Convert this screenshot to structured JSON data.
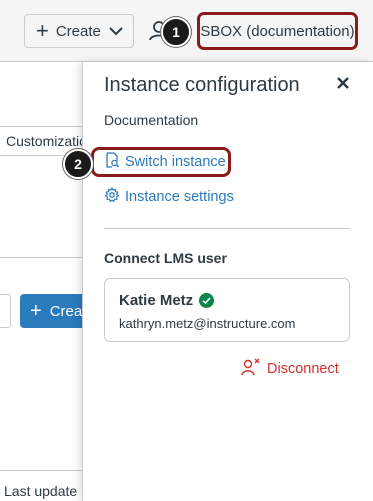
{
  "topbar": {
    "create_label": "Create",
    "instance_label": "SBOX (documentation)"
  },
  "callouts": {
    "one": "1",
    "two": "2"
  },
  "left": {
    "tab_label": "Customizatio",
    "create_label": "Crea",
    "last_updated_label": "Last update"
  },
  "panel": {
    "title": "Instance configuration",
    "subtitle": "Documentation",
    "switch_instance_label": "Switch instance",
    "instance_settings_label": "Instance settings",
    "lms_heading": "Connect LMS user",
    "user_name": "Katie Metz",
    "user_email": "kathryn.metz@instructure.com",
    "disconnect_label": "Disconnect"
  },
  "colors": {
    "link": "#2b7abc",
    "danger": "#d0342c",
    "success": "#0b874b",
    "highlight_border": "#8b1a1a",
    "primary_button": "#2b7abc"
  },
  "icons": [
    "plus-icon",
    "chevron-down-icon",
    "user-icon",
    "close-icon",
    "search-document-icon",
    "gear-icon",
    "check-circle-icon",
    "user-disconnect-icon"
  ]
}
